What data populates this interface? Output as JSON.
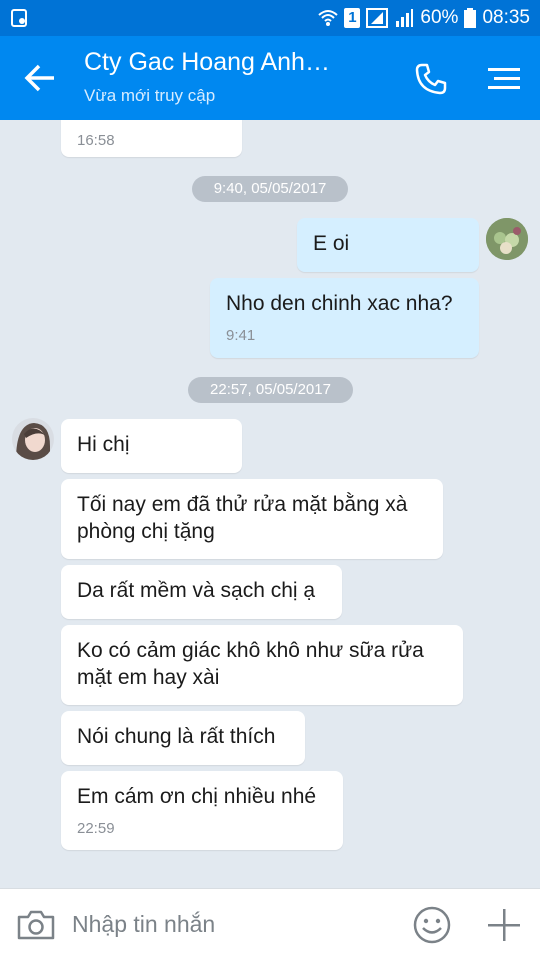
{
  "status_bar": {
    "battery_percent": "60%",
    "time": "08:35",
    "sim_label": "1"
  },
  "header": {
    "contact_name": "Cty Gac Hoang Anh…",
    "status": "Vừa mới truy cập"
  },
  "messages": {
    "prev_time": "16:58",
    "date_1": "9:40, 05/05/2017",
    "out_1": "E oi",
    "out_2": "Nho den chinh xac nha?",
    "out_2_time": "9:41",
    "date_2": "22:57, 05/05/2017",
    "in_1": "Hi chị",
    "in_2": "Tối nay em đã thử rửa mặt bằng xà phòng chị tặng",
    "in_3": "Da rất mềm và sạch chị ạ",
    "in_4": "Ko có cảm giác khô khô như sữa rửa mặt em hay xài",
    "in_5": "Nói chung là rất thích",
    "in_6": "Em cám ơn chị nhiều nhé",
    "in_6_time": "22:59"
  },
  "input": {
    "placeholder": "Nhập tin nhắn"
  },
  "colors": {
    "header": "#0088f0",
    "status_bar": "#0073d6",
    "chat_background": "#e2e9f0",
    "incoming_bubble": "#ffffff",
    "outgoing_bubble": "#d5efff"
  }
}
